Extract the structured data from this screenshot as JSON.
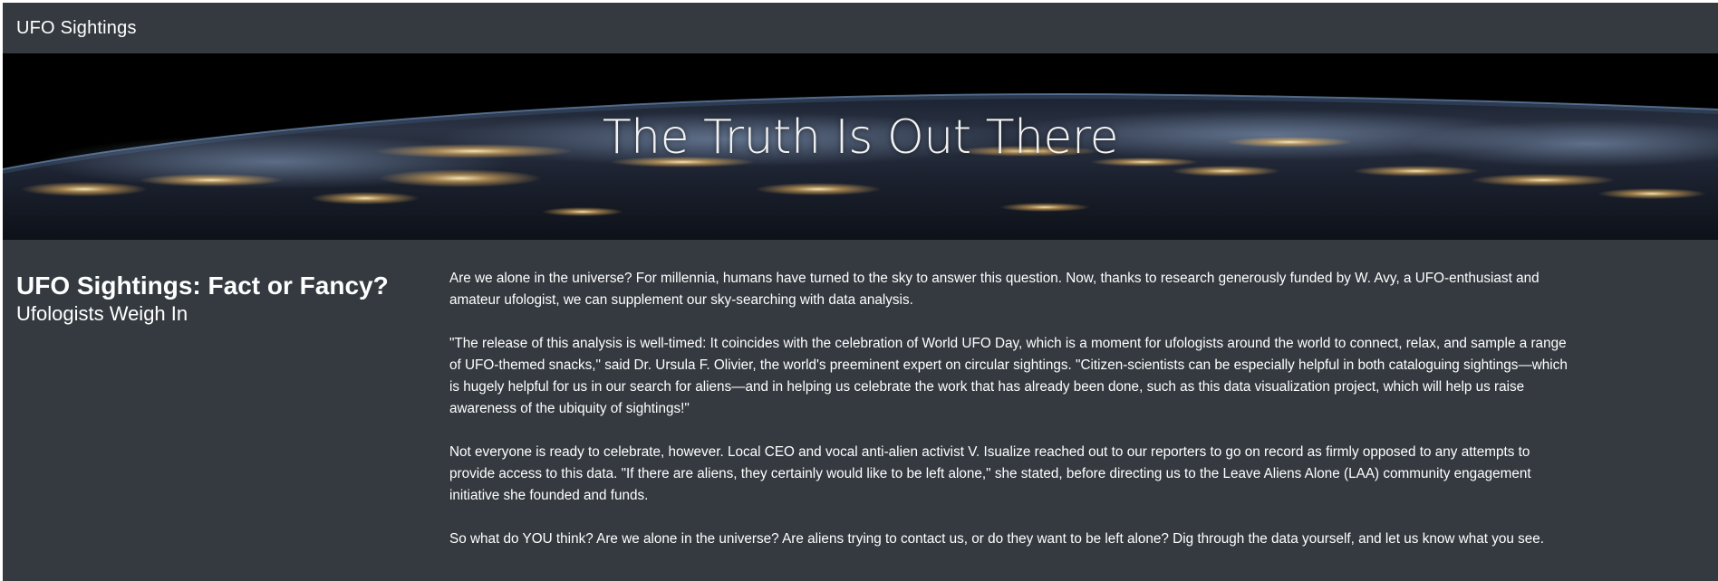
{
  "navbar": {
    "brand": "UFO Sightings"
  },
  "hero": {
    "title": "The Truth Is Out There",
    "background": "earth-at-night-from-orbit"
  },
  "sidebar": {
    "heading": "UFO Sightings: Fact or Fancy?",
    "subheading": "Ufologists Weigh In"
  },
  "article": {
    "paragraphs": [
      "Are we alone in the universe? For millennia, humans have turned to the sky to answer this question. Now, thanks to research generously funded by W. Avy, a UFO-enthusiast and amateur ufologist, we can supplement our sky-searching with data analysis.",
      "\"The release of this analysis is well-timed: It coincides with the celebration of World UFO Day, which is a moment for ufologists around the world to connect, relax, and sample a range of UFO-themed snacks,\" said Dr. Ursula F. Olivier, the world's preeminent expert on circular sightings. \"Citizen-scientists can be especially helpful in both cataloguing sightings—which is hugely helpful for us in our search for aliens—and in helping us celebrate the work that has already been done, such as this data visualization project, which will help us raise awareness of the ubiquity of sightings!\"",
      "Not everyone is ready to celebrate, however. Local CEO and vocal anti-alien activist V. Isualize reached out to our reporters to go on record as firmly opposed to any attempts to provide access to this data. \"If there are aliens, they certainly would like to be left alone,\" she stated, before directing us to the Leave Aliens Alone (LAA) community engagement initiative she founded and funds.",
      "So what do YOU think? Are we alone in the universe? Are aliens trying to contact us, or do they want to be left alone? Dig through the data yourself, and let us know what you see."
    ]
  },
  "colors": {
    "page_background": "#343a40",
    "text": "#ffffff"
  }
}
